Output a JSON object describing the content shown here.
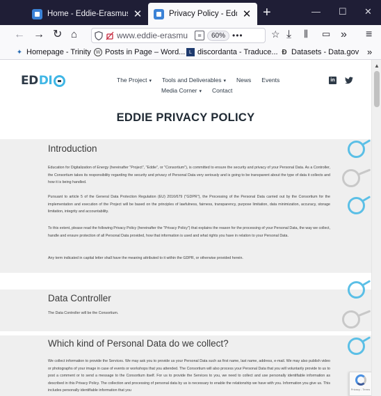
{
  "browser": {
    "tabs": [
      {
        "title": "Home - Eddie-Erasmus",
        "active": false
      },
      {
        "title": "Privacy Policy - Eddie-Era",
        "active": true
      }
    ],
    "new_tab_symbol": "+",
    "window_controls": {
      "minimize": "—",
      "maximize": "☐",
      "close": "✕"
    },
    "url": "www.eddie-erasmu",
    "zoom": "60%",
    "bookmarks": [
      {
        "label": "Homepage - Trinity",
        "icon": "trinity-icon"
      },
      {
        "label": "Posts in Page – Word...",
        "icon": "wordpress-icon"
      },
      {
        "label": "discordanta - Traduce...",
        "icon": "dictionary-icon"
      },
      {
        "label": "Datasets - Data.gov",
        "icon": "datagov-icon"
      }
    ],
    "colors": {
      "tabbar": "#1f1e36",
      "toolbar": "#f9f9fb"
    }
  },
  "site": {
    "logo_text": [
      "ED",
      "DI",
      "E"
    ],
    "menu_row1": [
      {
        "label": "The Project",
        "dropdown": true
      },
      {
        "label": "Tools and Deliverables",
        "dropdown": true
      },
      {
        "label": "News",
        "dropdown": false
      },
      {
        "label": "Events",
        "dropdown": false
      }
    ],
    "menu_row2": [
      {
        "label": "Media Corner",
        "dropdown": true
      },
      {
        "label": "Contact",
        "dropdown": false
      }
    ],
    "social": {
      "linkedin": "in",
      "twitter": "🐦"
    },
    "page_title": "EDDIE PRIVACY POLICY",
    "accent_color": "#5bbfe6"
  },
  "sections": {
    "intro": {
      "heading": "Introduction",
      "paragraphs": [
        "Education for Digitalization of Energy (hereinafter \"Project\", \"Eddie\", or \"Consortium\"), is committed to ensure the security and privacy of your Personal Data. As a Controller, the Consortium takes its responsibility regarding the security and privacy of Personal Data very seriously and is going to be transparent about the type of data it collects and how it is being handled.",
        "Pursuant to article 5 of the General Data Protection Regulation (EU) 2016/679 (\"GDPR\"), the Processing of the Personal Data carried out by the Consortium for the implementation and execution of the Project will be based on the principles of lawfulness, fairness, transparency, purpose limitation, data minimization, accuracy, storage limitation, integrity and accountability.",
        "To this extent, please read the following Privacy Policy (hereinafter the \"Privacy Policy\") that explains the reason for the processing of your Personal Data, the way we collect, handle and ensure protection of all Personal Data provided, how that information is used and what rights you have in relation to your Personal Data.",
        "Any term indicated in capital letter shall have the meaning attributed to it within the GDPR, or otherwise provided herein."
      ]
    },
    "controller": {
      "heading": "Data Controller",
      "paragraphs": [
        "The Data Controller will be the Consortium."
      ]
    },
    "collect": {
      "heading": "Which kind of Personal Data do we collect?",
      "paragraphs": [
        "We collect information to provide the Services. We may ask you to provide us your Personal Data such as first name, last name, address, e-mail. We may also publish video or photographs of your image in case of events or workshops that you attended. The Consortium will also process your Personal Data that you will voluntarily provide to us to post a comment or to send a message to the Consortium itself. For us to provide the Services to you, we need to collect and use personally identifiable information as described in this Privacy Policy. The collection and processing of personal data by us is necessary to enable the relationship we have with you. Information you give us. This includes personally identifiable information that you"
      ]
    }
  },
  "recaptcha": {
    "label": "Privacy - Terms"
  }
}
